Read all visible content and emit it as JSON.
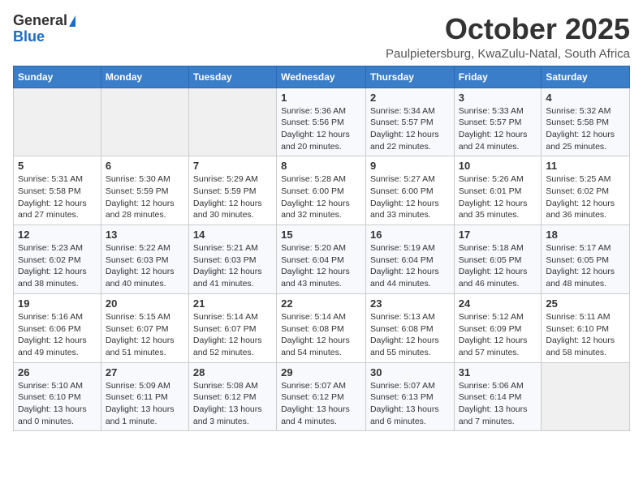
{
  "logo": {
    "general": "General",
    "blue": "Blue"
  },
  "title": {
    "month": "October 2025",
    "location": "Paulpietersburg, KwaZulu-Natal, South Africa"
  },
  "days_of_week": [
    "Sunday",
    "Monday",
    "Tuesday",
    "Wednesday",
    "Thursday",
    "Friday",
    "Saturday"
  ],
  "weeks": [
    [
      {
        "day": "",
        "info": ""
      },
      {
        "day": "",
        "info": ""
      },
      {
        "day": "",
        "info": ""
      },
      {
        "day": "1",
        "info": "Sunrise: 5:36 AM\nSunset: 5:56 PM\nDaylight: 12 hours\nand 20 minutes."
      },
      {
        "day": "2",
        "info": "Sunrise: 5:34 AM\nSunset: 5:57 PM\nDaylight: 12 hours\nand 22 minutes."
      },
      {
        "day": "3",
        "info": "Sunrise: 5:33 AM\nSunset: 5:57 PM\nDaylight: 12 hours\nand 24 minutes."
      },
      {
        "day": "4",
        "info": "Sunrise: 5:32 AM\nSunset: 5:58 PM\nDaylight: 12 hours\nand 25 minutes."
      }
    ],
    [
      {
        "day": "5",
        "info": "Sunrise: 5:31 AM\nSunset: 5:58 PM\nDaylight: 12 hours\nand 27 minutes."
      },
      {
        "day": "6",
        "info": "Sunrise: 5:30 AM\nSunset: 5:59 PM\nDaylight: 12 hours\nand 28 minutes."
      },
      {
        "day": "7",
        "info": "Sunrise: 5:29 AM\nSunset: 5:59 PM\nDaylight: 12 hours\nand 30 minutes."
      },
      {
        "day": "8",
        "info": "Sunrise: 5:28 AM\nSunset: 6:00 PM\nDaylight: 12 hours\nand 32 minutes."
      },
      {
        "day": "9",
        "info": "Sunrise: 5:27 AM\nSunset: 6:00 PM\nDaylight: 12 hours\nand 33 minutes."
      },
      {
        "day": "10",
        "info": "Sunrise: 5:26 AM\nSunset: 6:01 PM\nDaylight: 12 hours\nand 35 minutes."
      },
      {
        "day": "11",
        "info": "Sunrise: 5:25 AM\nSunset: 6:02 PM\nDaylight: 12 hours\nand 36 minutes."
      }
    ],
    [
      {
        "day": "12",
        "info": "Sunrise: 5:23 AM\nSunset: 6:02 PM\nDaylight: 12 hours\nand 38 minutes."
      },
      {
        "day": "13",
        "info": "Sunrise: 5:22 AM\nSunset: 6:03 PM\nDaylight: 12 hours\nand 40 minutes."
      },
      {
        "day": "14",
        "info": "Sunrise: 5:21 AM\nSunset: 6:03 PM\nDaylight: 12 hours\nand 41 minutes."
      },
      {
        "day": "15",
        "info": "Sunrise: 5:20 AM\nSunset: 6:04 PM\nDaylight: 12 hours\nand 43 minutes."
      },
      {
        "day": "16",
        "info": "Sunrise: 5:19 AM\nSunset: 6:04 PM\nDaylight: 12 hours\nand 44 minutes."
      },
      {
        "day": "17",
        "info": "Sunrise: 5:18 AM\nSunset: 6:05 PM\nDaylight: 12 hours\nand 46 minutes."
      },
      {
        "day": "18",
        "info": "Sunrise: 5:17 AM\nSunset: 6:05 PM\nDaylight: 12 hours\nand 48 minutes."
      }
    ],
    [
      {
        "day": "19",
        "info": "Sunrise: 5:16 AM\nSunset: 6:06 PM\nDaylight: 12 hours\nand 49 minutes."
      },
      {
        "day": "20",
        "info": "Sunrise: 5:15 AM\nSunset: 6:07 PM\nDaylight: 12 hours\nand 51 minutes."
      },
      {
        "day": "21",
        "info": "Sunrise: 5:14 AM\nSunset: 6:07 PM\nDaylight: 12 hours\nand 52 minutes."
      },
      {
        "day": "22",
        "info": "Sunrise: 5:14 AM\nSunset: 6:08 PM\nDaylight: 12 hours\nand 54 minutes."
      },
      {
        "day": "23",
        "info": "Sunrise: 5:13 AM\nSunset: 6:08 PM\nDaylight: 12 hours\nand 55 minutes."
      },
      {
        "day": "24",
        "info": "Sunrise: 5:12 AM\nSunset: 6:09 PM\nDaylight: 12 hours\nand 57 minutes."
      },
      {
        "day": "25",
        "info": "Sunrise: 5:11 AM\nSunset: 6:10 PM\nDaylight: 12 hours\nand 58 minutes."
      }
    ],
    [
      {
        "day": "26",
        "info": "Sunrise: 5:10 AM\nSunset: 6:10 PM\nDaylight: 13 hours\nand 0 minutes."
      },
      {
        "day": "27",
        "info": "Sunrise: 5:09 AM\nSunset: 6:11 PM\nDaylight: 13 hours\nand 1 minute."
      },
      {
        "day": "28",
        "info": "Sunrise: 5:08 AM\nSunset: 6:12 PM\nDaylight: 13 hours\nand 3 minutes."
      },
      {
        "day": "29",
        "info": "Sunrise: 5:07 AM\nSunset: 6:12 PM\nDaylight: 13 hours\nand 4 minutes."
      },
      {
        "day": "30",
        "info": "Sunrise: 5:07 AM\nSunset: 6:13 PM\nDaylight: 13 hours\nand 6 minutes."
      },
      {
        "day": "31",
        "info": "Sunrise: 5:06 AM\nSunset: 6:14 PM\nDaylight: 13 hours\nand 7 minutes."
      },
      {
        "day": "",
        "info": ""
      }
    ]
  ]
}
